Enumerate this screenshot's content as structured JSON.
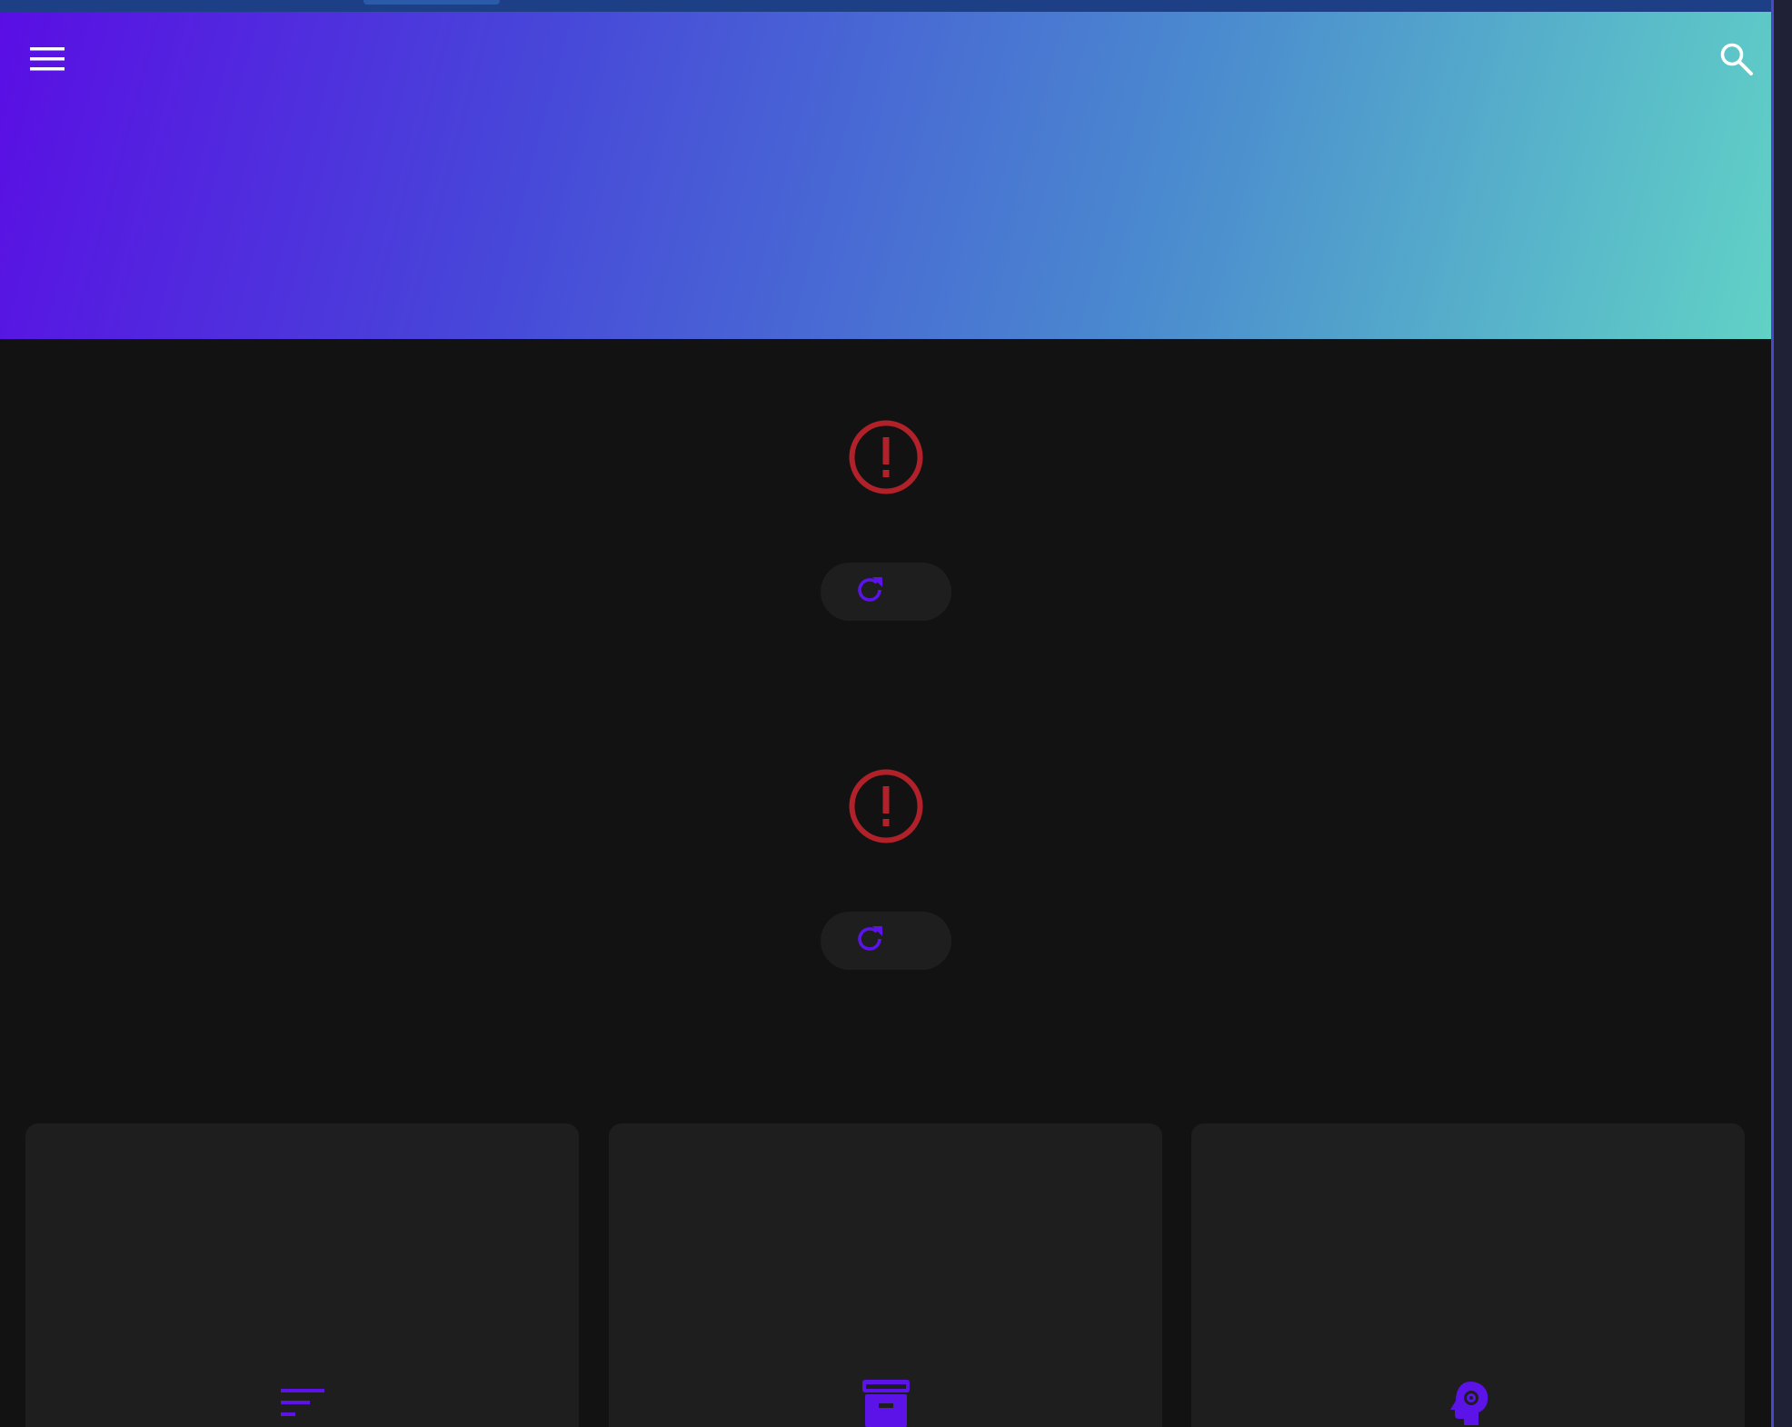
{
  "window": {
    "top_strip_color": "#1c3f86",
    "side_strip_color": "#1f2236"
  },
  "header": {
    "gradient_start": "#5a0ee4",
    "gradient_end": "#61d2c6",
    "menu_icon": "menu-icon",
    "search_icon": "search-icon"
  },
  "errors": [
    {
      "icon": "error-circle-icon",
      "retry_icon": "refresh-icon",
      "retry_label": ""
    },
    {
      "icon": "error-circle-icon",
      "retry_icon": "refresh-icon",
      "retry_label": ""
    }
  ],
  "cards": [
    {
      "icon": "sort-icon",
      "label": ""
    },
    {
      "icon": "archive-icon",
      "label": ""
    },
    {
      "icon": "psychology-icon",
      "label": ""
    }
  ],
  "colors": {
    "accent": "#5b13e8",
    "error": "#b0212a",
    "background": "#121212",
    "surface": "#1e1e1e"
  }
}
